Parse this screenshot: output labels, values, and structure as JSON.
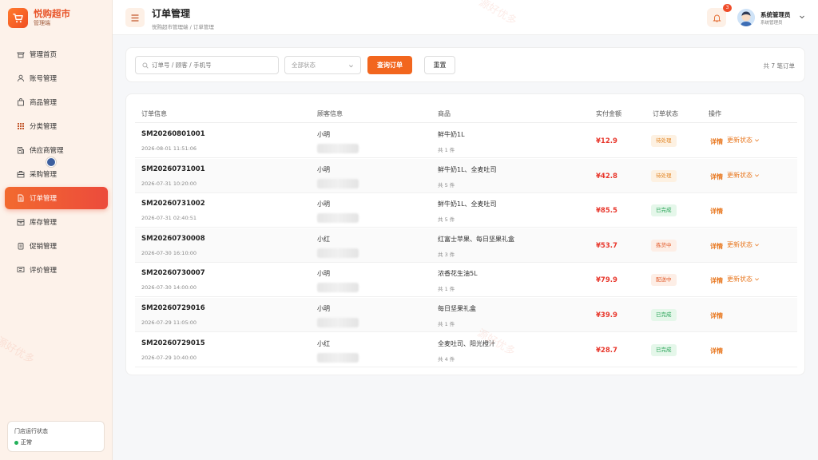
{
  "brand": {
    "name": "悦购超市",
    "sub": "管理端"
  },
  "nav": [
    {
      "label": "管理首页",
      "icon": "shop-icon"
    },
    {
      "label": "账号管理",
      "icon": "user-icon"
    },
    {
      "label": "商品管理",
      "icon": "bag-icon"
    },
    {
      "label": "分类管理",
      "icon": "grid-icon"
    },
    {
      "label": "供应商管理",
      "icon": "building-icon"
    },
    {
      "label": "采购管理",
      "icon": "briefcase-icon"
    },
    {
      "label": "订单管理",
      "icon": "document-icon",
      "active": true
    },
    {
      "label": "库存管理",
      "icon": "box-icon"
    },
    {
      "label": "促销管理",
      "icon": "tag-icon"
    },
    {
      "label": "评价管理",
      "icon": "comment-icon"
    }
  ],
  "store": {
    "title": "门店运行状态",
    "status": "正常"
  },
  "header": {
    "title": "订单管理",
    "breadcrumb": "悦购超市管理端 / 订单管理",
    "notifications": "3",
    "user_name": "系统管理员",
    "user_role": "系统管理员"
  },
  "filter": {
    "search_placeholder": "订单号 / 顾客 / 手机号",
    "status_value": "全部状态",
    "query_label": "查询订单",
    "reset_label": "重置",
    "total": "共 7 笔订单"
  },
  "table": {
    "headers": [
      "订单信息",
      "顾客信息",
      "商品",
      "实付金额",
      "订单状态",
      "操作"
    ],
    "detail_label": "详情",
    "update_label": "更新状态",
    "rows": [
      {
        "order": "SM20260801001",
        "time": "2026-08-01 11:51:06",
        "customer": "小明",
        "goods": "鲜牛奶1L",
        "qty": "共 1 件",
        "amount": "¥12.9",
        "status": "待处理",
        "status_type": "pending",
        "updatable": true
      },
      {
        "order": "SM20260731001",
        "time": "2026-07-31 10:20:00",
        "customer": "小明",
        "goods": "鲜牛奶1L、全麦吐司",
        "qty": "共 5 件",
        "amount": "¥42.8",
        "status": "待处理",
        "status_type": "pending",
        "updatable": true
      },
      {
        "order": "SM20260731002",
        "time": "2026-07-31 02:40:51",
        "customer": "小明",
        "goods": "鲜牛奶1L、全麦吐司",
        "qty": "共 5 件",
        "amount": "¥85.5",
        "status": "已完成",
        "status_type": "done",
        "updatable": false
      },
      {
        "order": "SM20260730008",
        "time": "2026-07-30 16:10:00",
        "customer": "小红",
        "goods": "红富士苹果、每日坚果礼盒",
        "qty": "共 3 件",
        "amount": "¥53.7",
        "status": "拣货中",
        "status_type": "picking",
        "updatable": true
      },
      {
        "order": "SM20260730007",
        "time": "2026-07-30 14:00:00",
        "customer": "小明",
        "goods": "浓香花生油5L",
        "qty": "共 1 件",
        "amount": "¥79.9",
        "status": "配送中",
        "status_type": "shipping",
        "updatable": true
      },
      {
        "order": "SM20260729016",
        "time": "2026-07-29 11:05:00",
        "customer": "小明",
        "goods": "每日坚果礼盒",
        "qty": "共 1 件",
        "amount": "¥39.9",
        "status": "已完成",
        "status_type": "done",
        "updatable": false
      },
      {
        "order": "SM20260729015",
        "time": "2026-07-29 10:40:00",
        "customer": "小红",
        "goods": "全麦吐司、阳光橙汁",
        "qty": "共 4 件",
        "amount": "¥28.7",
        "status": "已完成",
        "status_type": "done",
        "updatable": false
      }
    ]
  },
  "colors": {
    "accent": "#f2661e",
    "danger": "#e8372c",
    "success": "#26a356"
  }
}
